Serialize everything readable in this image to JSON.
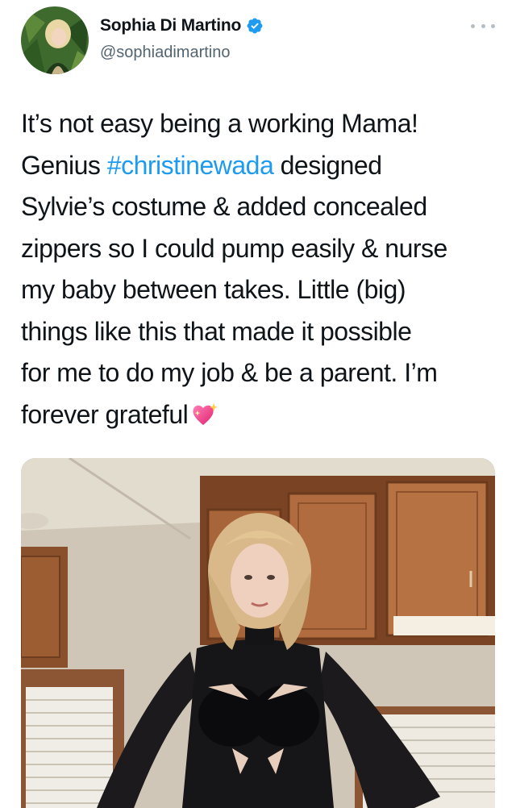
{
  "author": {
    "display_name": "Sophia Di Martino",
    "handle": "@sophiadimartino",
    "verified_icon": "verified-badge-icon",
    "avatar_icon": "avatar-photo"
  },
  "tweet": {
    "line1": "It’s not easy being a working Mama!",
    "line2_before": "Genius ",
    "hashtag": "#christinewada",
    "line2_after": " designed",
    "line3": "Sylvie’s costume & added concealed",
    "line4": "zippers so I could pump easily & nurse",
    "line5": "my baby between takes. Little (big)",
    "line6": "things like this that made it possible",
    "line7": "for me to do my job & be a parent. I’m",
    "line8": "forever grateful",
    "emoji_icon": "sparkling-heart-icon"
  },
  "colors": {
    "link": "#1d9bf0",
    "text": "#0f1419",
    "secondary": "#536471",
    "verified": "#1d9bf0"
  },
  "media": {
    "type": "photo",
    "icon": "photo-media"
  },
  "more_icon": "more-options-icon"
}
